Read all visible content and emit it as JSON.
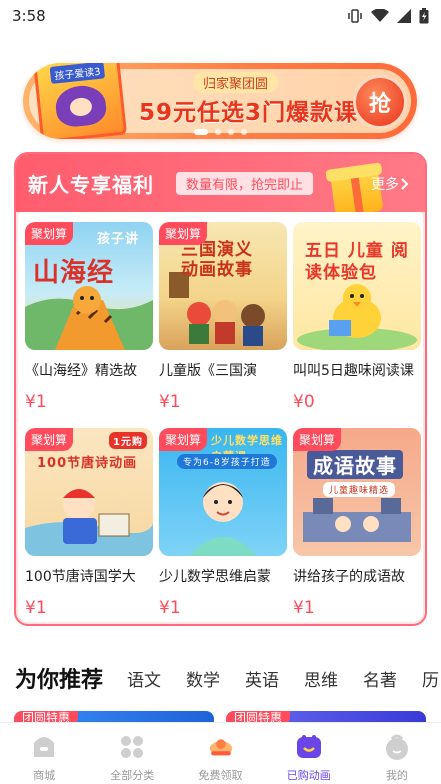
{
  "status_bar": {
    "time": "3:58"
  },
  "banner": {
    "book_title": "孩子爱读3",
    "tag": "归家聚团圆",
    "title": "59元任选3门爆款课",
    "button": "抢"
  },
  "welfare": {
    "title": "新人专享福利",
    "note": "数量有限，抢完即止",
    "more": "更多",
    "courses": [
      {
        "tag": "聚划算",
        "name": "《山海经》精选故",
        "price": "¥1",
        "thumb_title": "山海经",
        "thumb_sub": "孩子讲"
      },
      {
        "tag": "聚划算",
        "name": "儿童版《三国演",
        "price": "¥1",
        "thumb_title": "三国演义 动画故事",
        "thumb_sub": ""
      },
      {
        "tag": "",
        "name": "叫叫5日趣味阅读课",
        "price": "¥0",
        "thumb_title": "五日 儿童 阅读体验包",
        "thumb_sub": ""
      },
      {
        "tag": "聚划算",
        "name": "100节唐诗国学大",
        "price": "¥1",
        "thumb_title": "100节唐诗动画",
        "thumb_sub": "1元购"
      },
      {
        "tag": "聚划算",
        "name": "少儿数学思维启蒙",
        "price": "¥1",
        "thumb_title": "少儿数学思维启蒙课",
        "thumb_sub": "专为6-8岁孩子打造"
      },
      {
        "tag": "聚划算",
        "name": "讲给孩子的成语故",
        "price": "¥1",
        "thumb_title": "成语故事",
        "thumb_sub": "儿童趣味精选"
      }
    ]
  },
  "recommend": {
    "title": "为你推荐",
    "tabs": [
      "语文",
      "数学",
      "英语",
      "思维",
      "名著",
      "历"
    ],
    "card_tags": [
      "团圆特惠",
      "团圆特惠"
    ]
  },
  "tabbar": {
    "items": [
      {
        "label": "商城",
        "icon": "shop-icon"
      },
      {
        "label": "全部分类",
        "icon": "category-icon"
      },
      {
        "label": "免费领取",
        "icon": "free-gift-icon"
      },
      {
        "label": "已购动画",
        "icon": "purchased-animation-icon"
      },
      {
        "label": "我的",
        "icon": "profile-icon"
      }
    ],
    "active": "已购动画"
  },
  "colors": {
    "accent_red": "#ff4b5c",
    "banner_orange": "#ff7f45",
    "tab_active": "#6a45e8"
  }
}
